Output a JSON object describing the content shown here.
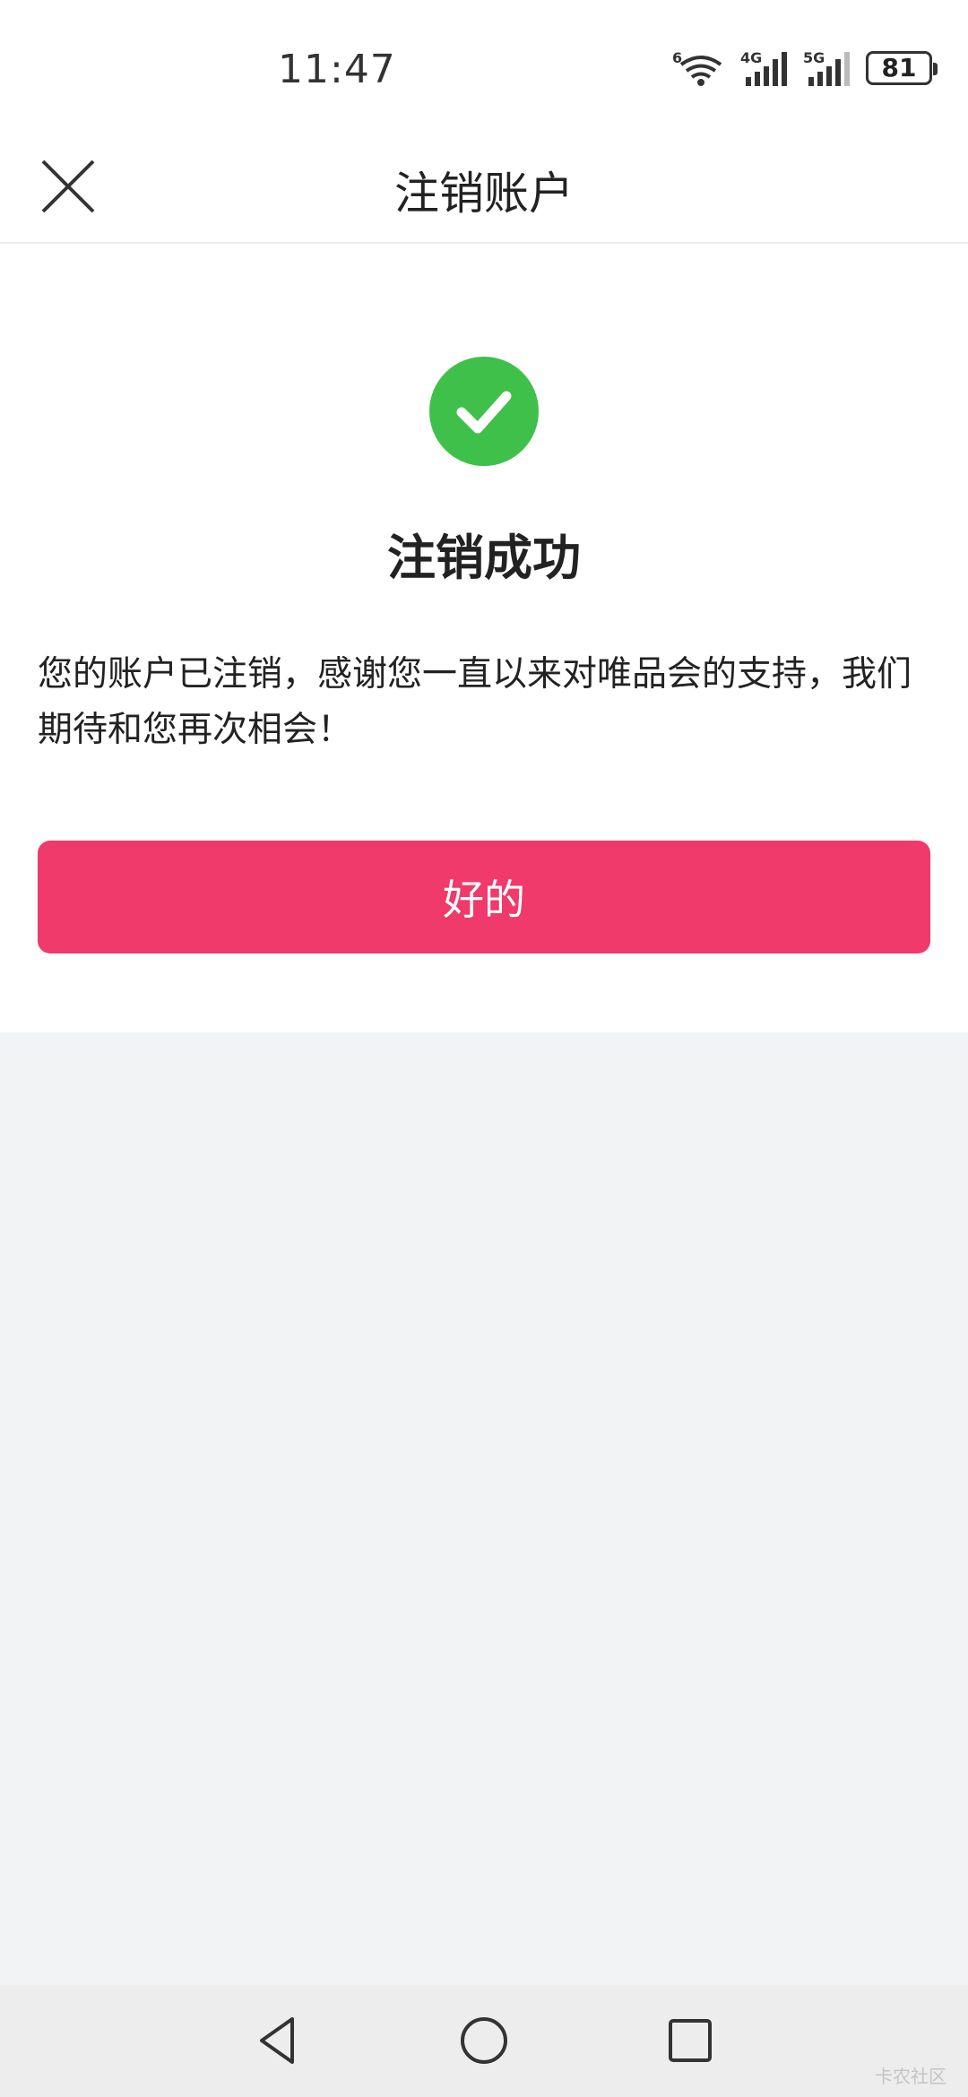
{
  "status_bar": {
    "time": "11:47",
    "wifi_label": "6",
    "cell1_label": "4G",
    "cell2_label": "5G",
    "battery": "81"
  },
  "header": {
    "title": "注销账户",
    "close_icon": "close-icon"
  },
  "main": {
    "success_icon": "check-circle-icon",
    "success_color": "#3fc04a",
    "title": "注销成功",
    "message": "您的账户已注销，感谢您一直以来对唯品会的支持，我们期待和您再次相会！",
    "ok_button": "好的",
    "accent_color": "#ef3a6b"
  },
  "nav_bar": {
    "back_icon": "back-triangle-icon",
    "home_icon": "home-circle-icon",
    "recent_icon": "recent-square-icon",
    "watermark": "卡农社区"
  }
}
